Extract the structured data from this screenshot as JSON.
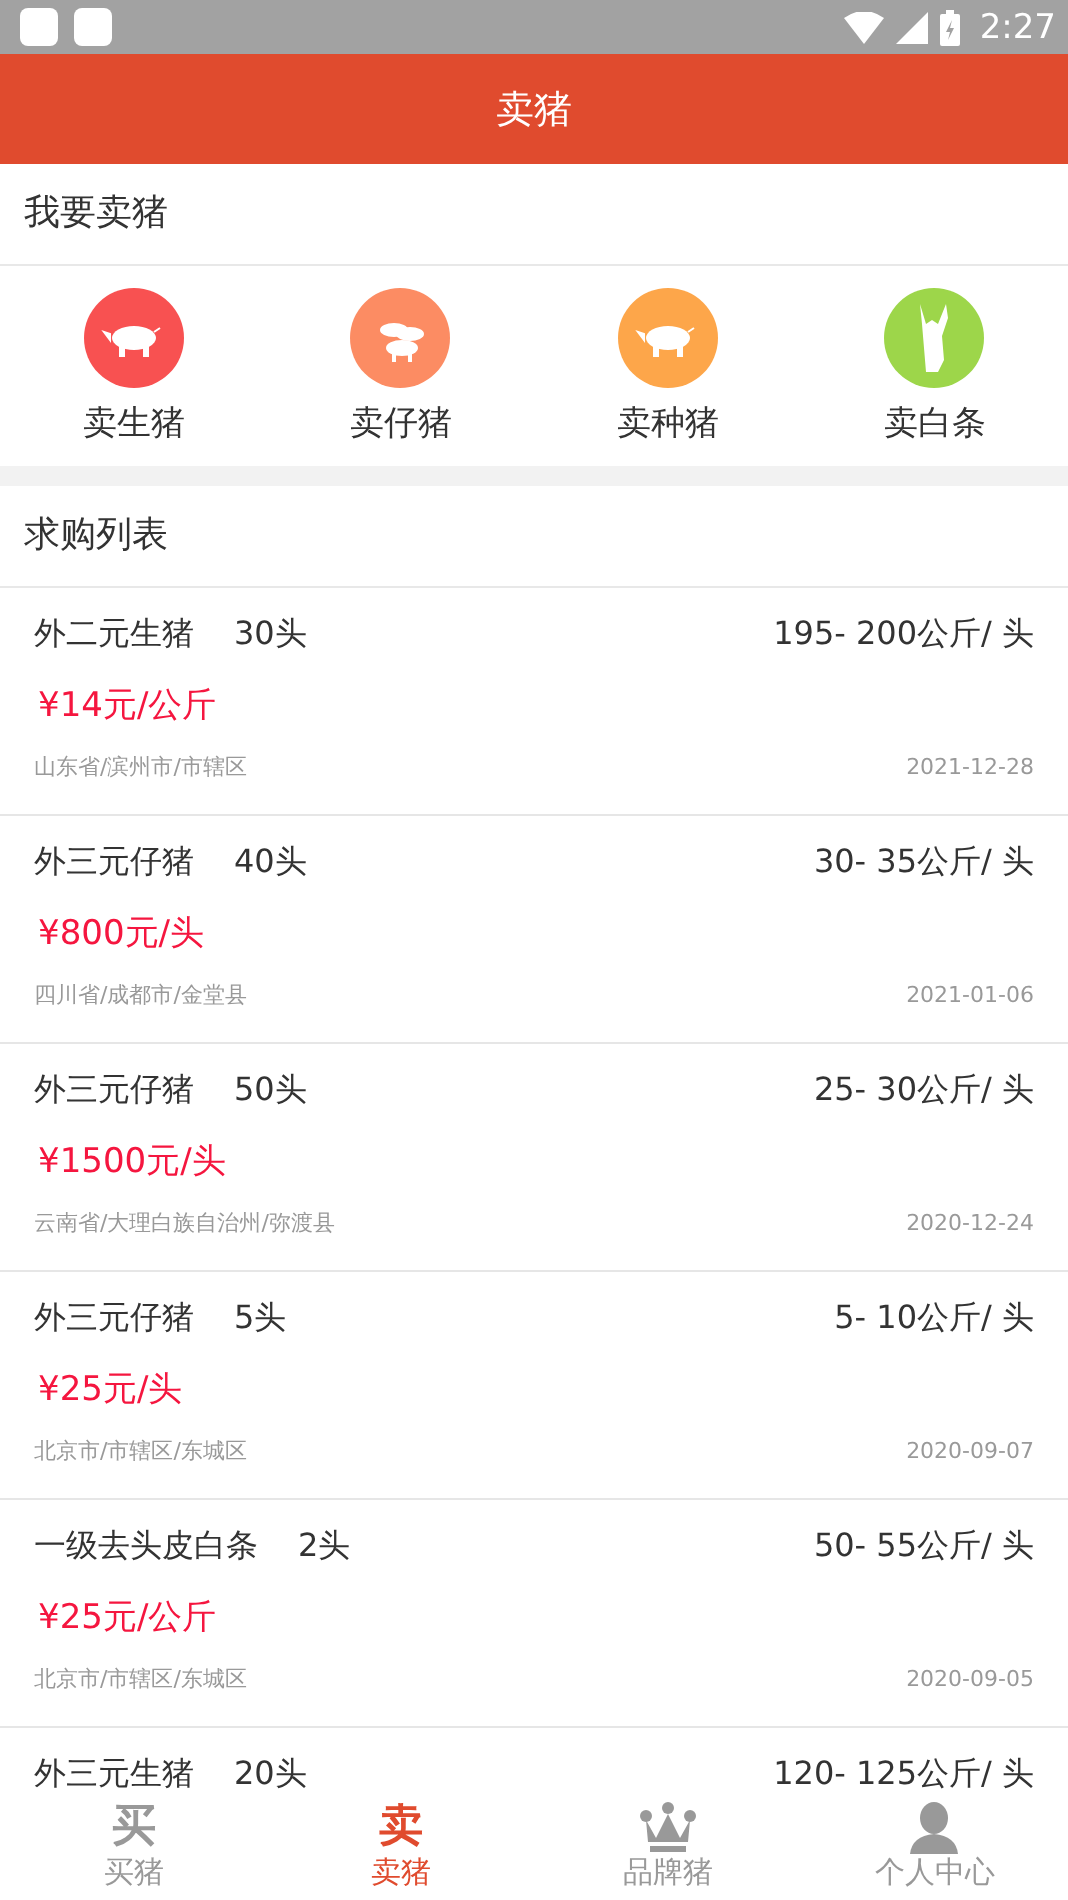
{
  "status_bar": {
    "time": "2:27"
  },
  "header": {
    "title": "卖猪"
  },
  "sell_section": {
    "title": "我要卖猪",
    "categories": [
      {
        "label": "卖生猪",
        "kind": "pig",
        "color": "#f85151"
      },
      {
        "label": "卖仔猪",
        "kind": "piglets",
        "color": "#fc8c63"
      },
      {
        "label": "卖种猪",
        "kind": "pig",
        "color": "#fda64a"
      },
      {
        "label": "卖白条",
        "kind": "carcass",
        "color": "#9dd64a"
      }
    ]
  },
  "purchase_list": {
    "title": "求购列表",
    "rows": [
      {
        "breed": "外二元生猪",
        "count": "30头",
        "weight": "195- 200公斤/ 头",
        "price": "¥14元/公斤",
        "location": "山东省/滨州市/市辖区",
        "date": "2021-12-28"
      },
      {
        "breed": "外三元仔猪",
        "count": "40头",
        "weight": "30- 35公斤/ 头",
        "price": "¥800元/头",
        "location": "四川省/成都市/金堂县",
        "date": "2021-01-06"
      },
      {
        "breed": "外三元仔猪",
        "count": "50头",
        "weight": "25- 30公斤/ 头",
        "price": "¥1500元/头",
        "location": "云南省/大理白族自治州/弥渡县",
        "date": "2020-12-24"
      },
      {
        "breed": "外三元仔猪",
        "count": "5头",
        "weight": "5- 10公斤/ 头",
        "price": "¥25元/头",
        "location": "北京市/市辖区/东城区",
        "date": "2020-09-07"
      },
      {
        "breed": "一级去头皮白条",
        "count": "2头",
        "weight": "50- 55公斤/ 头",
        "price": "¥25元/公斤",
        "location": "北京市/市辖区/东城区",
        "date": "2020-09-05"
      },
      {
        "breed": "外三元生猪",
        "count": "20头",
        "weight": "120- 125公斤/ 头"
      }
    ]
  },
  "bottom_nav": [
    {
      "label": "买猪",
      "kind": "glyph",
      "glyph": "买",
      "selected": false
    },
    {
      "label": "卖猪",
      "kind": "glyph",
      "glyph": "卖",
      "selected": true
    },
    {
      "label": "品牌猪",
      "kind": "crown",
      "selected": false
    },
    {
      "label": "个人中心",
      "kind": "person",
      "selected": false
    }
  ]
}
